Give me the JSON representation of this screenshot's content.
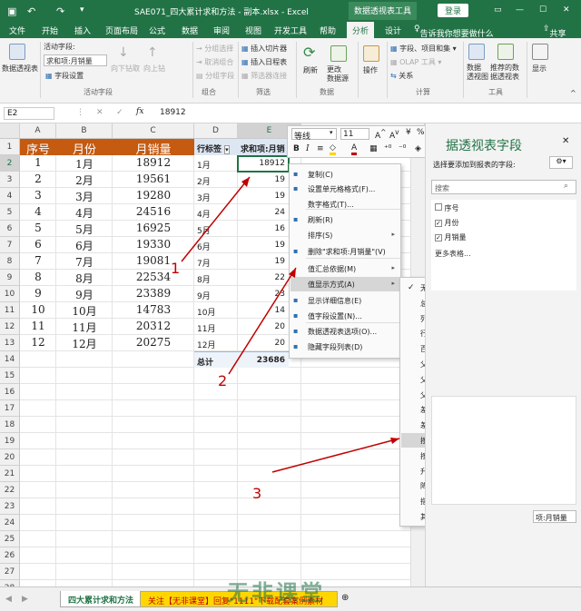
{
  "titlebar": {
    "filename": "SAE071_四大累计求和方法 - 副本.xlsx",
    "app": "Excel",
    "context_tool": "数据透视表工具",
    "login": "登录"
  },
  "ribbon_tabs": [
    "文件",
    "开始",
    "插入",
    "页面布局",
    "公式",
    "数据",
    "审阅",
    "视图",
    "开发工具",
    "帮助",
    "分析",
    "设计"
  ],
  "tell_me": "告诉我你想要做什么",
  "share": "共享",
  "ribbon": {
    "pivot_table": "数据透视表",
    "active_field_label": "活动字段:",
    "active_field_value": "求和项:月销量",
    "field_settings": "字段设置",
    "drill_down": "向下钻取",
    "drill_up": "向上钻",
    "group_active_field": "活动字段",
    "group_selection": "→ 分组选择",
    "ungroup": "取消组合",
    "group_field": "分组字段",
    "group_group": "组合",
    "insert_slicer": "插入切片器",
    "insert_timeline": "插入日程表",
    "filter_connections": "筛选器连接",
    "group_filter": "筛选",
    "refresh": "刷新",
    "change_source": "更改\n数据源",
    "group_data": "数据",
    "actions": "操作",
    "fields_items": "字段、项目和集",
    "olap_tools": "OLAP 工具",
    "relationships": "关系",
    "group_calc": "计算",
    "pivot_chart": "数据\n透视图",
    "recommended": "推荐的数\n据透视表",
    "group_tools": "工具",
    "show": "显示"
  },
  "formula": {
    "cell_ref": "E2",
    "fx": "fx",
    "value": "18912"
  },
  "columns": [
    "A",
    "B",
    "C",
    "D",
    "E"
  ],
  "rows": [
    "1",
    "2",
    "3",
    "4",
    "5",
    "6",
    "7",
    "8",
    "9",
    "10",
    "11",
    "12",
    "13",
    "14",
    "15",
    "16",
    "17",
    "18",
    "19",
    "20",
    "21",
    "22",
    "23",
    "24",
    "25",
    "26",
    "27",
    "28"
  ],
  "table_headers": [
    "序号",
    "月份",
    "月销量"
  ],
  "table": [
    [
      "1",
      "1月",
      "18912"
    ],
    [
      "2",
      "2月",
      "19561"
    ],
    [
      "3",
      "3月",
      "19280"
    ],
    [
      "4",
      "4月",
      "24516"
    ],
    [
      "5",
      "5月",
      "16925"
    ],
    [
      "6",
      "6月",
      "19330"
    ],
    [
      "7",
      "7月",
      "19081"
    ],
    [
      "8",
      "8月",
      "22534"
    ],
    [
      "9",
      "9月",
      "23389"
    ],
    [
      "10",
      "10月",
      "14783"
    ],
    [
      "11",
      "11月",
      "20312"
    ],
    [
      "12",
      "12月",
      "20275"
    ]
  ],
  "pivot": {
    "row_label_header": "行标签",
    "value_header": "求和项:月销",
    "months": [
      "1月",
      "2月",
      "3月",
      "4月",
      "5月",
      "6月",
      "7月",
      "8月",
      "9月",
      "10月",
      "11月",
      "12月"
    ],
    "values_partial": [
      "18912",
      "19",
      "19",
      "24",
      "16",
      "19",
      "19",
      "22",
      "23",
      "14",
      "20",
      "20"
    ],
    "total_label": "总计",
    "total_value": "23686"
  },
  "minibar": {
    "font": "等线",
    "size": "11"
  },
  "context_menu": [
    {
      "label": "复制(C)",
      "icon": "copy-icon"
    },
    {
      "label": "设置单元格格式(F)...",
      "icon": "format-cells-icon"
    },
    {
      "label": "数字格式(T)...",
      "icon": ""
    },
    {
      "label": "刷新(R)",
      "icon": "refresh-icon"
    },
    {
      "label": "排序(S)",
      "icon": "",
      "submenu": true
    },
    {
      "label": "删除\"求和项:月销量\"(V)",
      "icon": "delete-icon"
    },
    {
      "label": "值汇总依据(M)",
      "icon": "",
      "submenu": true
    },
    {
      "label": "值显示方式(A)",
      "icon": "",
      "submenu": true,
      "highlight": true
    },
    {
      "label": "显示详细信息(E)",
      "icon": "show-details-icon"
    },
    {
      "label": "值字段设置(N)...",
      "icon": "field-settings-icon"
    },
    {
      "label": "数据透视表选项(O)...",
      "icon": "pivot-options-icon"
    },
    {
      "label": "隐藏字段列表(D)",
      "icon": "field-list-icon"
    }
  ],
  "submenu": [
    {
      "label": "无计算(N)",
      "checked": true
    },
    {
      "label": "总计的百分比(G)"
    },
    {
      "label": "列汇总的百分比(C)"
    },
    {
      "label": "行汇总的百分比(R)"
    },
    {
      "label": "百分比(O)..."
    },
    {
      "label": "父行汇总的百分比(P)"
    },
    {
      "label": "父列汇总的百分比(A)"
    },
    {
      "label": "父级汇总的百分比(E)..."
    },
    {
      "label": "差异(D)..."
    },
    {
      "label": "差异百分比(F)..."
    },
    {
      "label": "按某一字段汇总(I)...",
      "highlight": true
    },
    {
      "label": "按某一字段汇总的百分比(U)..."
    },
    {
      "label": "升序排列(S)..."
    },
    {
      "label": "降序排列(L)..."
    },
    {
      "label": "指数(I)"
    },
    {
      "label": "其他选项(M)..."
    }
  ],
  "field_pane": {
    "title": "据透视表字段",
    "subtitle": "选择要添加到报表的字段:",
    "search": "搜索",
    "fields": [
      {
        "label": "序号",
        "checked": false
      },
      {
        "label": "月份",
        "checked": true
      },
      {
        "label": "月销量",
        "checked": true
      }
    ],
    "more_tables": "更多表格...",
    "value_area_item": "项:月销量"
  },
  "annotations": [
    "1",
    "2",
    "3"
  ],
  "sheet_tabs": [
    "四大累计求和方法",
    "关注【无非课堂】回复\"1111\"下载配套案例素材"
  ],
  "watermark": "无非课堂"
}
